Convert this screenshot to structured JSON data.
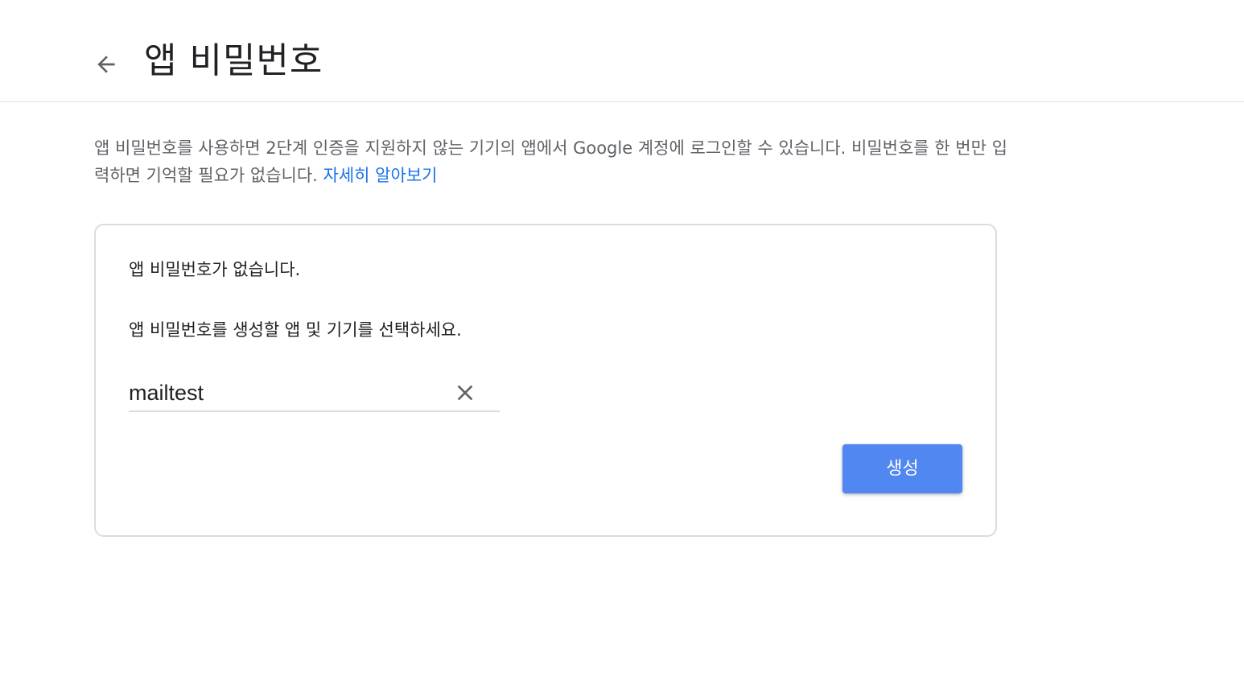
{
  "header": {
    "back_icon": "arrow-back-icon",
    "title": "앱 비밀번호"
  },
  "description": {
    "text": "앱 비밀번호를 사용하면 2단계 인증을 지원하지 않는 기기의 앱에서 Google 계정에 로그인할 수 있습니다. 비밀번호를 한 번만 입력하면 기억할 필요가 없습니다. ",
    "link_label": "자세히 알아보기",
    "link_color": "#1a73e8"
  },
  "card": {
    "empty_message": "앱 비밀번호가 없습니다.",
    "select_prompt": "앱 비밀번호를 생성할 앱 및 기기를 선택하세요.",
    "app_name_input": {
      "value": "mailtest",
      "clear_icon": "close-icon"
    },
    "generate_button": {
      "label": "생성",
      "color": "#5087f0"
    }
  }
}
